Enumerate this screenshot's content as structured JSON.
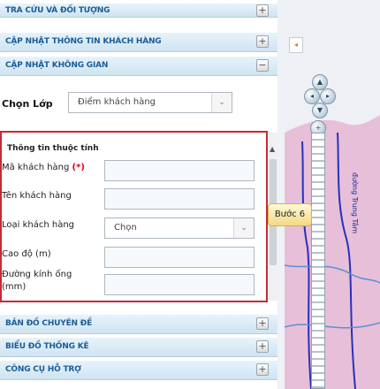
{
  "panel": {
    "sections": [
      {
        "label": "TRA CỨU VÀ ĐỐI TƯỢNG",
        "btn": "+"
      },
      {
        "label": "CẬP NHẬT THÔNG TIN KHÁCH HÀNG",
        "btn": "+"
      },
      {
        "label": "CẬP NHẬT KHÔNG GIAN",
        "btn": "−"
      }
    ],
    "layer": {
      "label": "Chọn Lớp",
      "value": "Điểm khách hàng",
      "caret": "⌄"
    },
    "attributes": {
      "title": "Thông tin thuộc tính",
      "fields": [
        {
          "label": "Mã khách hàng",
          "required": "(*)"
        },
        {
          "label": "Tên khách hàng",
          "required": ""
        },
        {
          "label": "Loại khách hàng",
          "required": ""
        },
        {
          "label": "Cao độ (m)",
          "required": ""
        },
        {
          "label": "Đường kính ống",
          "label2": "(mm)",
          "required": ""
        }
      ],
      "type_select_value": "Chọn",
      "type_select_caret": "⌄"
    },
    "bottom_sections": [
      {
        "label": "BẢN ĐỒ CHUYÊN ĐỀ",
        "btn": "+"
      },
      {
        "label": "BIỂU ĐỒ THỐNG KÊ",
        "btn": "+"
      },
      {
        "label": "CÔNG CỤ HỖ TRỢ",
        "btn": "+"
      }
    ],
    "scroll_up": "▲"
  },
  "map": {
    "collapse_arrow": "◂",
    "step_tooltip": "Bước 6",
    "road_label": "đường Trung Tâm",
    "pan_up": "▲",
    "pan_left": "◂",
    "pan_right": "▸",
    "pan_down": "▼",
    "zoom_in": "+",
    "colors": {
      "land": "#e7bfd9",
      "water": "#5b8fd3",
      "road": "#2831b8",
      "highlight": "#ffd400"
    }
  }
}
